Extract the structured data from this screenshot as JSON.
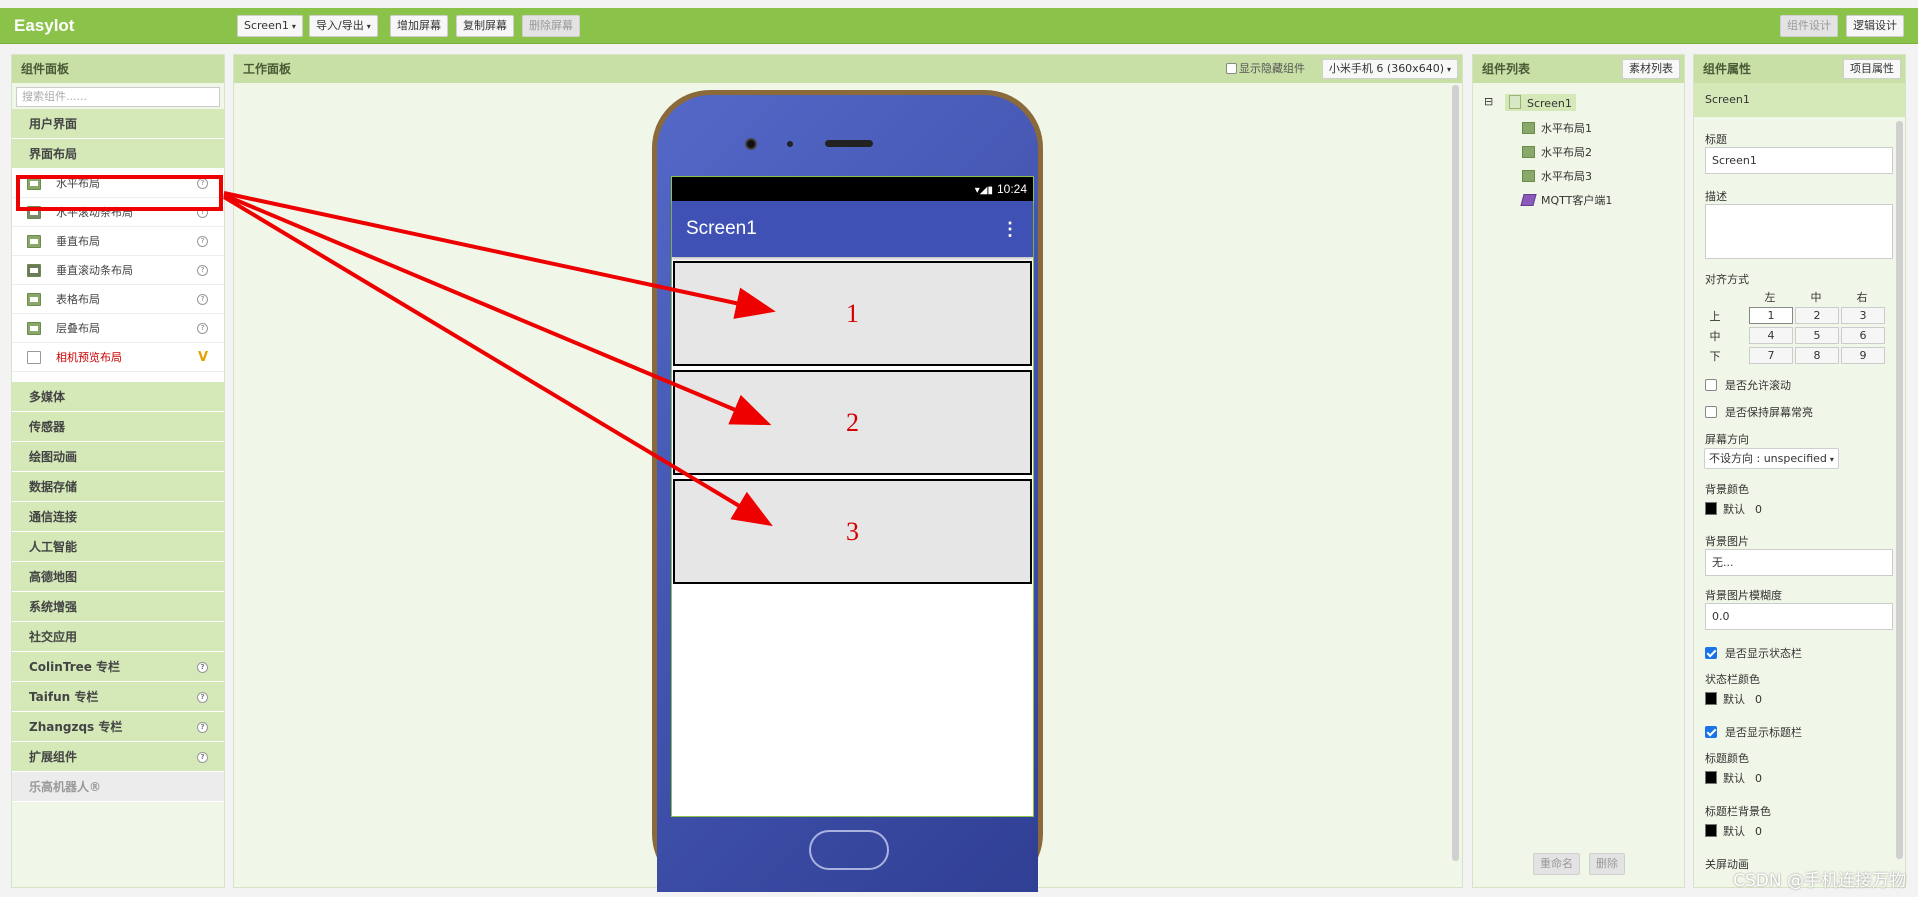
{
  "app": {
    "title": "Easylot"
  },
  "toolbar": {
    "screen_select": "Screen1",
    "import_export": "导入/导出",
    "add_screen": "增加屏幕",
    "copy_screen": "复制屏幕",
    "delete_screen": "删除屏幕",
    "designer": "组件设计",
    "blocks": "逻辑设计"
  },
  "palette": {
    "title": "组件面板",
    "search_placeholder": "搜索组件......",
    "cat_ui": "用户界面",
    "cat_layout": "界面布局",
    "layout_items": [
      {
        "label": "水平布局"
      },
      {
        "label": "水平滚动条布局"
      },
      {
        "label": "垂直布局"
      },
      {
        "label": "垂直滚动条布局"
      },
      {
        "label": "表格布局"
      },
      {
        "label": "层叠布局"
      },
      {
        "label": "相机预览布局"
      }
    ],
    "categories": [
      {
        "label": "多媒体"
      },
      {
        "label": "传感器"
      },
      {
        "label": "绘图动画"
      },
      {
        "label": "数据存储"
      },
      {
        "label": "通信连接"
      },
      {
        "label": "人工智能"
      },
      {
        "label": "高德地图"
      },
      {
        "label": "系统增强"
      },
      {
        "label": "社交应用"
      },
      {
        "label": "ColinTree 专栏"
      },
      {
        "label": "Taifun 专栏"
      },
      {
        "label": "Zhangzqs 专栏"
      },
      {
        "label": "扩展组件"
      },
      {
        "label": "乐高机器人®"
      }
    ],
    "help_mark": "?",
    "v_mark": "V"
  },
  "viewer": {
    "title": "工作面板",
    "show_hidden": "显示隐藏组件",
    "device_select": "小米手机 6 (360x640)",
    "status_time": "10:24",
    "status_icons": "▾◢▮",
    "screen_title": "Screen1",
    "kebab": "⋮",
    "boxes": [
      "1",
      "2",
      "3"
    ]
  },
  "components": {
    "title": "组件列表",
    "assets_button": "素材列表",
    "collapse": "⊟",
    "root": "Screen1",
    "children": [
      "水平布局1",
      "水平布局2",
      "水平布局3",
      "MQTT客户端1"
    ],
    "rename": "重命名",
    "delete": "删除"
  },
  "properties": {
    "title": "组件属性",
    "project_button": "项目属性",
    "component": "Screen1",
    "title_label": "标题",
    "title_value": "Screen1",
    "desc_label": "描述",
    "align_label": "对齐方式",
    "align_cols": [
      "左",
      "中",
      "右"
    ],
    "align_rows": [
      "上",
      "中",
      "下"
    ],
    "align_cells": [
      "1",
      "2",
      "3",
      "4",
      "5",
      "6",
      "7",
      "8",
      "9"
    ],
    "scroll_label": "是否允许滚动",
    "keep_on_label": "是否保持屏幕常亮",
    "orientation_label": "屏幕方向",
    "orientation_value": "不设方向 : unspecified",
    "bgcolor_label": "背景颜色",
    "default_text": "默认",
    "zero": "0",
    "bgimage_label": "背景图片",
    "bgimage_value": "无...",
    "blur_label": "背景图片模糊度",
    "blur_value": "0.0",
    "show_status_label": "是否显示状态栏",
    "status_color_label": "状态栏颜色",
    "show_titlebar_label": "是否显示标题栏",
    "title_color_label": "标题颜色",
    "titlebar_bg_label": "标题栏背景色",
    "close_anim_label": "关屏动画"
  },
  "watermark": "CSDN @手机连接万物",
  "colors": {
    "topbar": "#8bc34a",
    "header": "#c8e0a6",
    "appbar": "#3f51b5",
    "annotation": "#e00000"
  }
}
